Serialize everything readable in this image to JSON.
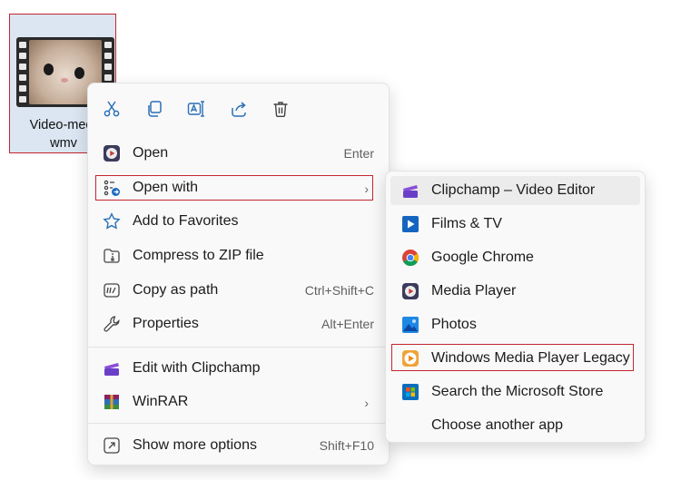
{
  "file": {
    "label_line1": "Video-meo-",
    "label_line2": "wmv"
  },
  "toolbar": [
    {
      "name": "cut",
      "icon": "scissors-icon"
    },
    {
      "name": "copy",
      "icon": "copy-icon"
    },
    {
      "name": "rename",
      "icon": "rename-icon"
    },
    {
      "name": "share",
      "icon": "share-icon"
    },
    {
      "name": "delete",
      "icon": "trash-icon"
    }
  ],
  "menu": {
    "open": {
      "label": "Open",
      "shortcut": "Enter"
    },
    "open_with": {
      "label": "Open with"
    },
    "favorites": {
      "label": "Add to Favorites"
    },
    "zip": {
      "label": "Compress to ZIP file"
    },
    "copy_path": {
      "label": "Copy as path",
      "shortcut": "Ctrl+Shift+C"
    },
    "properties": {
      "label": "Properties",
      "shortcut": "Alt+Enter"
    },
    "clipchamp": {
      "label": "Edit with Clipchamp"
    },
    "winrar": {
      "label": "WinRAR"
    },
    "more": {
      "label": "Show more options",
      "shortcut": "Shift+F10"
    }
  },
  "submenu": {
    "clipchamp": "Clipchamp – Video Editor",
    "films": "Films & TV",
    "chrome": "Google Chrome",
    "media_player": "Media Player",
    "photos": "Photos",
    "wmp_legacy": "Windows Media Player Legacy",
    "store": "Search the Microsoft Store",
    "another": "Choose another app"
  },
  "colors": {
    "accent": "#1a6ac0",
    "highlight_border": "#c4262e",
    "menu_bg": "#f9f9f9"
  }
}
